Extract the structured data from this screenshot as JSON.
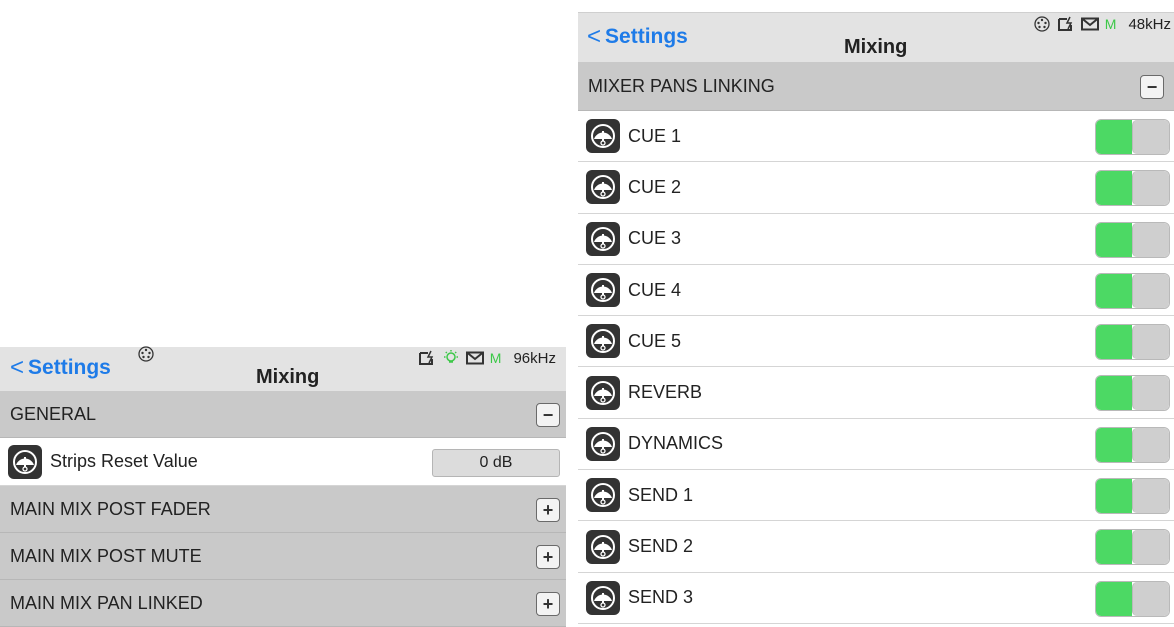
{
  "left": {
    "nav": {
      "back_label": "Settings",
      "title": "Mixing",
      "status_m": "M",
      "sample_rate": "96kHz"
    },
    "general": {
      "header": "GENERAL",
      "button": "−",
      "strips_reset": {
        "label": "Strips Reset Value",
        "value": "0 dB"
      }
    },
    "sections": [
      {
        "label": "MAIN MIX POST FADER",
        "button": "+"
      },
      {
        "label": "MAIN MIX POST MUTE",
        "button": "+"
      },
      {
        "label": "MAIN MIX PAN LINKED",
        "button": "+"
      }
    ]
  },
  "right": {
    "nav": {
      "back_label": "Settings",
      "title": "Mixing",
      "status_m": "M",
      "sample_rate": "48kHz"
    },
    "section": {
      "header": "MIXER PANS LINKING",
      "button": "−"
    },
    "items": [
      {
        "label": "CUE 1",
        "on": true
      },
      {
        "label": "CUE 2",
        "on": true
      },
      {
        "label": "CUE 3",
        "on": true
      },
      {
        "label": "CUE 4",
        "on": true
      },
      {
        "label": "CUE 5",
        "on": true
      },
      {
        "label": "REVERB",
        "on": true
      },
      {
        "label": "DYNAMICS",
        "on": true
      },
      {
        "label": "SEND 1",
        "on": true
      },
      {
        "label": "SEND 2",
        "on": true
      },
      {
        "label": "SEND 3",
        "on": true
      }
    ]
  },
  "colors": {
    "accent": "#1e7be8",
    "toggle_on": "#4cd964",
    "section_bg": "#c9c9c9",
    "nav_bg": "#e3e3e3"
  }
}
